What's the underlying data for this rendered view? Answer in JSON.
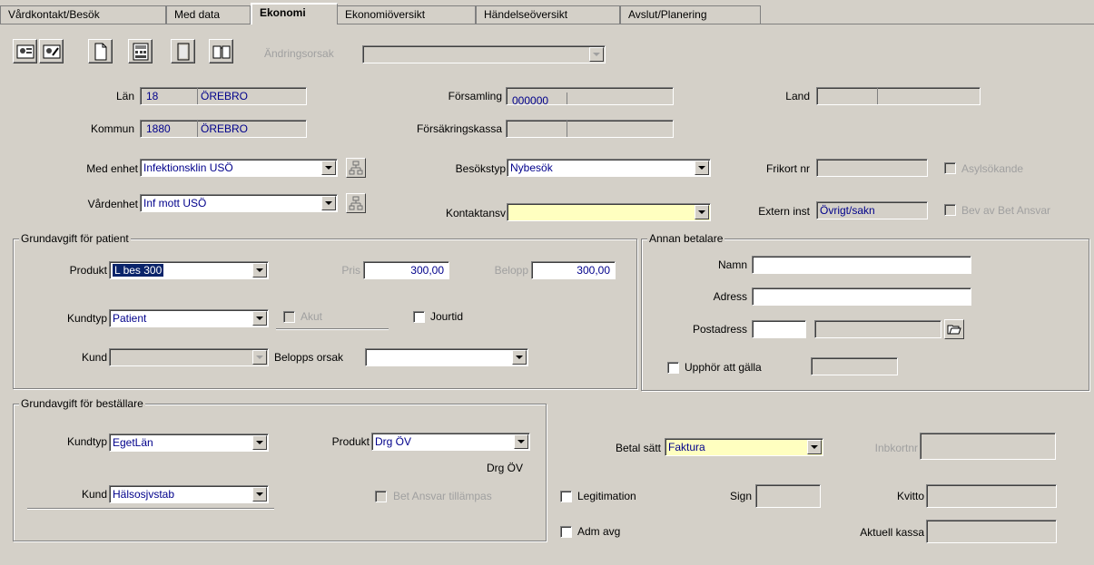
{
  "tabs": [
    "Vårdkontakt/Besök",
    "Med data",
    "Ekonomi",
    "Ekonomiöversikt",
    "Händelseöversikt",
    "Avslut/Planering"
  ],
  "toolbar": {
    "icons": [
      "patient-card-icon",
      "patient-card-edit-icon",
      "new-document-icon",
      "calculator-icon",
      "blank-page-icon",
      "book-icon"
    ],
    "andringsorsak_label": "Ändringsorsak",
    "andringsorsak_value": ""
  },
  "top": {
    "lan_label": "Län",
    "lan_code": "18",
    "lan_name": "ÖREBRO",
    "kommun_label": "Kommun",
    "kommun_code": "1880",
    "kommun_name": "ÖREBRO",
    "forsamling_label": "Församling",
    "forsamling_code": "000000",
    "forsamling_name": "",
    "forsakringskassa_label": "Försäkringskassa",
    "forsakringskassa_code": "",
    "forsakringskassa_name": "",
    "land_label": "Land",
    "land_code": "",
    "land_name": "",
    "med_enhet_label": "Med enhet",
    "med_enhet_value": "Infektionsklin USÖ",
    "vardenhet_label": "Vårdenhet",
    "vardenhet_value": "Inf mott USÖ",
    "besokstyp_label": "Besökstyp",
    "besokstyp_value": "Nybesök",
    "kontaktansv_label": "Kontaktansv",
    "kontaktansv_value": "",
    "frikort_label": "Frikort nr",
    "frikort_value": "",
    "extern_label": "Extern inst",
    "extern_value": "Övrigt/sakn",
    "asylsokande_label": "Asylsökande",
    "bev_label": "Bev av Bet Ansvar"
  },
  "patient_fee": {
    "title": "Grundavgift för patient",
    "produkt_label": "Produkt",
    "produkt_value": "L bes 300",
    "pris_label": "Pris",
    "pris_value": "300,00",
    "belopp_label": "Belopp",
    "belopp_value": "300,00",
    "kundtyp_label": "Kundtyp",
    "kundtyp_value": "Patient",
    "akut_label": "Akut",
    "jourtid_label": "Jourtid",
    "kund_label": "Kund",
    "kund_value": "",
    "belopps_orsak_label": "Belopps orsak",
    "belopps_orsak_value": ""
  },
  "other_payer": {
    "title": "Annan betalare",
    "namn_label": "Namn",
    "namn_value": "",
    "adress_label": "Adress",
    "adress_value": "",
    "postadress_label": "Postadress",
    "postnr_value": "",
    "ort_value": "",
    "upphor_label": "Upphör att gälla",
    "upphor_value": ""
  },
  "orderer_fee": {
    "title": "Grundavgift för beställare",
    "kundtyp_label": "Kundtyp",
    "kundtyp_value": "EgetLän",
    "produkt_label": "Produkt",
    "produkt_value": "Drg ÖV",
    "produkt_text": "Drg ÖV",
    "kund_label": "Kund",
    "kund_value": "Hälsosjvstab",
    "bet_ansvar_label": "Bet Ansvar tillämpas"
  },
  "payment": {
    "betal_satt_label": "Betal sätt",
    "betal_satt_value": "Faktura",
    "inbkortnr_label": "Inbkortnr",
    "inbkortnr_value": "",
    "legitimation_label": "Legitimation",
    "sign_label": "Sign",
    "sign_value": "",
    "kvitto_label": "Kvitto",
    "kvitto_value": "",
    "adm_avg_label": "Adm avg",
    "aktuell_kassa_label": "Aktuell kassa",
    "aktuell_kassa_value": ""
  }
}
